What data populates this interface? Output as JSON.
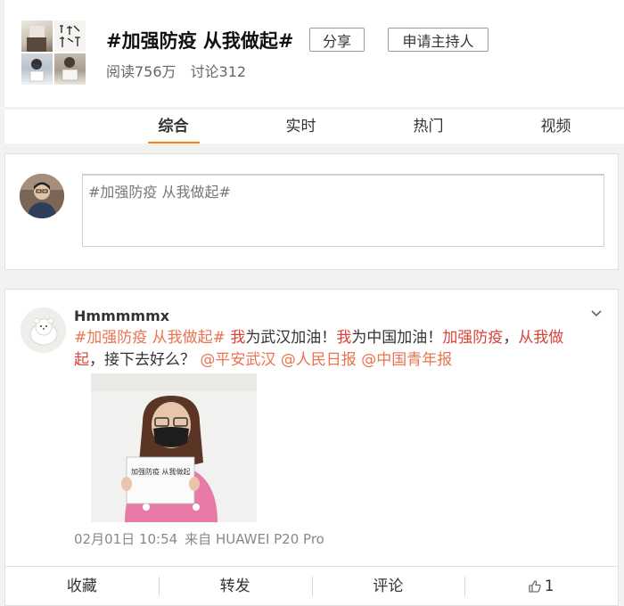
{
  "topic": {
    "title": "#加强防疫 从我做起#",
    "share_label": "分享",
    "host_label": "申请主持人",
    "reads": "阅读756万",
    "discussions": "讨论312",
    "cover_text": "坚防线 我做"
  },
  "tabs": [
    {
      "label": "综合",
      "active": true
    },
    {
      "label": "实时",
      "active": false
    },
    {
      "label": "热门",
      "active": false
    },
    {
      "label": "视频",
      "active": false
    }
  ],
  "composer": {
    "value": "#加强防疫 从我做起#"
  },
  "post": {
    "author": "Hmmmmmx",
    "segments": [
      {
        "text": "#加强防疫 从我做起#",
        "style": "tag"
      },
      {
        "text": " ",
        "style": "plain"
      },
      {
        "text": "我",
        "style": "hl"
      },
      {
        "text": "为武汉加油！",
        "style": "plain"
      },
      {
        "text": "我",
        "style": "hl"
      },
      {
        "text": "为中国加油！",
        "style": "plain"
      },
      {
        "text": "加强防疫",
        "style": "hl"
      },
      {
        "text": "，",
        "style": "plain"
      },
      {
        "text": "从我做起",
        "style": "hl"
      },
      {
        "text": "，接下去好么？ ",
        "style": "plain"
      },
      {
        "text": "@平安武汉",
        "style": "mention"
      },
      {
        "text": " ",
        "style": "plain"
      },
      {
        "text": "@人民日报",
        "style": "mention"
      },
      {
        "text": " ",
        "style": "plain"
      },
      {
        "text": "@中国青年报",
        "style": "mention"
      }
    ],
    "photo_sign_text": "加强防疫 从我做起",
    "time": "02月01日 10:54",
    "source": "来自 HUAWEI P20 Pro",
    "actions": {
      "favorite": "收藏",
      "repost": "转发",
      "comment": "评论",
      "like_count": "1"
    }
  },
  "colors": {
    "accent": "#ff8200",
    "highlight": "#d9433a",
    "link": "#eb7350"
  }
}
